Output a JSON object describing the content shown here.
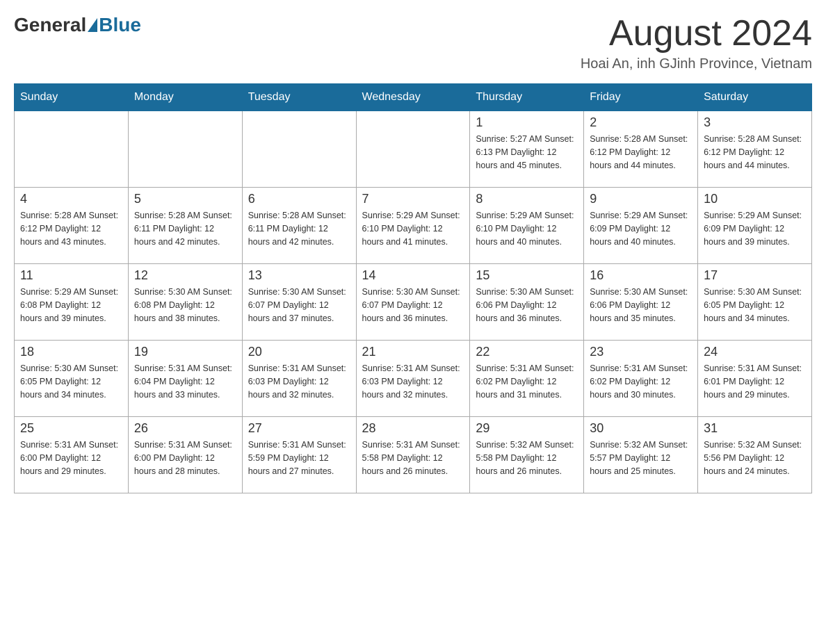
{
  "header": {
    "logo_general": "General",
    "logo_blue": "Blue",
    "month_title": "August 2024",
    "location": "Hoai An, inh GJinh Province, Vietnam"
  },
  "days_of_week": [
    "Sunday",
    "Monday",
    "Tuesday",
    "Wednesday",
    "Thursday",
    "Friday",
    "Saturday"
  ],
  "weeks": [
    [
      {
        "day": "",
        "info": ""
      },
      {
        "day": "",
        "info": ""
      },
      {
        "day": "",
        "info": ""
      },
      {
        "day": "",
        "info": ""
      },
      {
        "day": "1",
        "info": "Sunrise: 5:27 AM\nSunset: 6:13 PM\nDaylight: 12 hours\nand 45 minutes."
      },
      {
        "day": "2",
        "info": "Sunrise: 5:28 AM\nSunset: 6:12 PM\nDaylight: 12 hours\nand 44 minutes."
      },
      {
        "day": "3",
        "info": "Sunrise: 5:28 AM\nSunset: 6:12 PM\nDaylight: 12 hours\nand 44 minutes."
      }
    ],
    [
      {
        "day": "4",
        "info": "Sunrise: 5:28 AM\nSunset: 6:12 PM\nDaylight: 12 hours\nand 43 minutes."
      },
      {
        "day": "5",
        "info": "Sunrise: 5:28 AM\nSunset: 6:11 PM\nDaylight: 12 hours\nand 42 minutes."
      },
      {
        "day": "6",
        "info": "Sunrise: 5:28 AM\nSunset: 6:11 PM\nDaylight: 12 hours\nand 42 minutes."
      },
      {
        "day": "7",
        "info": "Sunrise: 5:29 AM\nSunset: 6:10 PM\nDaylight: 12 hours\nand 41 minutes."
      },
      {
        "day": "8",
        "info": "Sunrise: 5:29 AM\nSunset: 6:10 PM\nDaylight: 12 hours\nand 40 minutes."
      },
      {
        "day": "9",
        "info": "Sunrise: 5:29 AM\nSunset: 6:09 PM\nDaylight: 12 hours\nand 40 minutes."
      },
      {
        "day": "10",
        "info": "Sunrise: 5:29 AM\nSunset: 6:09 PM\nDaylight: 12 hours\nand 39 minutes."
      }
    ],
    [
      {
        "day": "11",
        "info": "Sunrise: 5:29 AM\nSunset: 6:08 PM\nDaylight: 12 hours\nand 39 minutes."
      },
      {
        "day": "12",
        "info": "Sunrise: 5:30 AM\nSunset: 6:08 PM\nDaylight: 12 hours\nand 38 minutes."
      },
      {
        "day": "13",
        "info": "Sunrise: 5:30 AM\nSunset: 6:07 PM\nDaylight: 12 hours\nand 37 minutes."
      },
      {
        "day": "14",
        "info": "Sunrise: 5:30 AM\nSunset: 6:07 PM\nDaylight: 12 hours\nand 36 minutes."
      },
      {
        "day": "15",
        "info": "Sunrise: 5:30 AM\nSunset: 6:06 PM\nDaylight: 12 hours\nand 36 minutes."
      },
      {
        "day": "16",
        "info": "Sunrise: 5:30 AM\nSunset: 6:06 PM\nDaylight: 12 hours\nand 35 minutes."
      },
      {
        "day": "17",
        "info": "Sunrise: 5:30 AM\nSunset: 6:05 PM\nDaylight: 12 hours\nand 34 minutes."
      }
    ],
    [
      {
        "day": "18",
        "info": "Sunrise: 5:30 AM\nSunset: 6:05 PM\nDaylight: 12 hours\nand 34 minutes."
      },
      {
        "day": "19",
        "info": "Sunrise: 5:31 AM\nSunset: 6:04 PM\nDaylight: 12 hours\nand 33 minutes."
      },
      {
        "day": "20",
        "info": "Sunrise: 5:31 AM\nSunset: 6:03 PM\nDaylight: 12 hours\nand 32 minutes."
      },
      {
        "day": "21",
        "info": "Sunrise: 5:31 AM\nSunset: 6:03 PM\nDaylight: 12 hours\nand 32 minutes."
      },
      {
        "day": "22",
        "info": "Sunrise: 5:31 AM\nSunset: 6:02 PM\nDaylight: 12 hours\nand 31 minutes."
      },
      {
        "day": "23",
        "info": "Sunrise: 5:31 AM\nSunset: 6:02 PM\nDaylight: 12 hours\nand 30 minutes."
      },
      {
        "day": "24",
        "info": "Sunrise: 5:31 AM\nSunset: 6:01 PM\nDaylight: 12 hours\nand 29 minutes."
      }
    ],
    [
      {
        "day": "25",
        "info": "Sunrise: 5:31 AM\nSunset: 6:00 PM\nDaylight: 12 hours\nand 29 minutes."
      },
      {
        "day": "26",
        "info": "Sunrise: 5:31 AM\nSunset: 6:00 PM\nDaylight: 12 hours\nand 28 minutes."
      },
      {
        "day": "27",
        "info": "Sunrise: 5:31 AM\nSunset: 5:59 PM\nDaylight: 12 hours\nand 27 minutes."
      },
      {
        "day": "28",
        "info": "Sunrise: 5:31 AM\nSunset: 5:58 PM\nDaylight: 12 hours\nand 26 minutes."
      },
      {
        "day": "29",
        "info": "Sunrise: 5:32 AM\nSunset: 5:58 PM\nDaylight: 12 hours\nand 26 minutes."
      },
      {
        "day": "30",
        "info": "Sunrise: 5:32 AM\nSunset: 5:57 PM\nDaylight: 12 hours\nand 25 minutes."
      },
      {
        "day": "31",
        "info": "Sunrise: 5:32 AM\nSunset: 5:56 PM\nDaylight: 12 hours\nand 24 minutes."
      }
    ]
  ]
}
